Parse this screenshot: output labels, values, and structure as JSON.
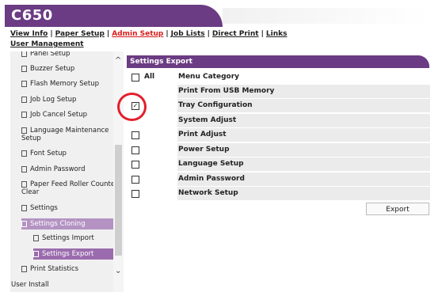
{
  "header": {
    "title": "C650"
  },
  "nav": {
    "links": [
      "View Info",
      "Paper Setup",
      "Admin Setup",
      "Job Lists",
      "Direct Print",
      "Links",
      "User Management"
    ],
    "active": "Admin Setup"
  },
  "sidebar": {
    "items": [
      "Panel Setup",
      "Buzzer Setup",
      "Flash Memory Setup",
      "Job Log Setup",
      "Job Cancel Setup",
      "Language Maintenance Setup",
      "Font Setup",
      "Admin Password",
      "Paper Feed Roller Counter Clear",
      "Settings",
      "Settings Cloning",
      "Settings Import",
      "Settings Export",
      "Print Statistics",
      "User Install"
    ]
  },
  "panel": {
    "title": "Settings Export",
    "all_label": "All",
    "column_header": "Menu Category",
    "rows": [
      {
        "label": "Print From USB Memory",
        "checked": false
      },
      {
        "label": "Tray Configuration",
        "checked": true
      },
      {
        "label": "System Adjust",
        "checked": false
      },
      {
        "label": "Print Adjust",
        "checked": false
      },
      {
        "label": "Power Setup",
        "checked": false
      },
      {
        "label": "Language Setup",
        "checked": false
      },
      {
        "label": "Admin Password",
        "checked": false
      },
      {
        "label": "Network Setup",
        "checked": false
      }
    ],
    "export_button": "Export"
  },
  "colors": {
    "brand": "#6b3b83",
    "active_link": "#d81b1b",
    "highlight": "#e41e2b"
  }
}
